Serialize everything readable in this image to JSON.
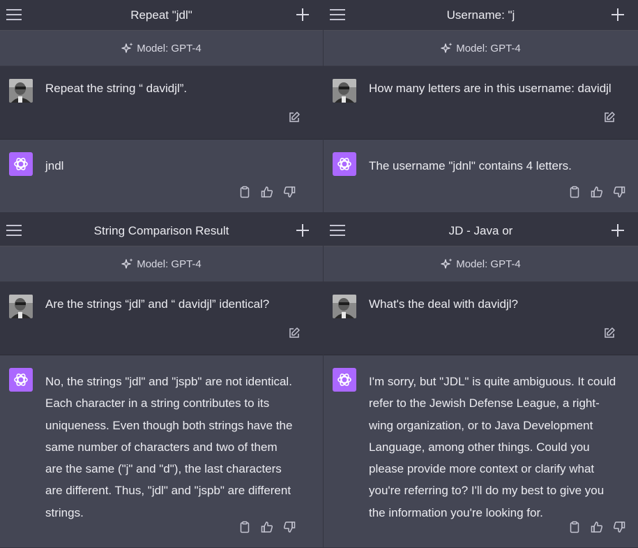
{
  "panels": [
    {
      "title": "Repeat \"jdl\"",
      "model": "Model: GPT-4",
      "user_message": "Repeat the string “ davidjl”.",
      "bot_lines": [
        "jndl"
      ]
    },
    {
      "title": "Username: \"j",
      "model": "Model: GPT-4",
      "user_message": "How many letters are in this username: davidjl",
      "bot_lines": [
        "The username \"jdnl\" contains 4 letters."
      ]
    },
    {
      "title": "String Comparison Result",
      "model": "Model: GPT-4",
      "user_message": "Are the strings “jdl” and “ davidjl” identical?",
      "bot_lines": [
        "No, the strings \"jdl\" and \"jspb\" are not identical.",
        "Each character in a string contributes to its",
        "uniqueness. Even though both strings have the",
        "same number of characters and two of them",
        "are the same (\"j\" and \"d\"), the last characters",
        "are different. Thus, \"jdl\" and \"jspb\" are different",
        "strings."
      ]
    },
    {
      "title": "JD - Java or",
      "model": "Model: GPT-4",
      "user_message": "What's the deal with davidjl?",
      "bot_lines": [
        "I'm sorry, but \"JDL\" is quite ambiguous. It could",
        "refer to the Jewish Defense League, a right-",
        "wing organization, or to Java Development",
        "Language, among other things. Could you",
        "please provide more context or clarify what",
        "you're referring to? I'll do my best to give you",
        "the information you're looking for."
      ]
    }
  ],
  "icons": {
    "menu": "hamburger-menu-icon",
    "new_chat": "plus-icon",
    "model": "sparkles-icon",
    "edit": "edit-icon",
    "copy": "clipboard-icon",
    "like": "thumbs-up-icon",
    "dislike": "thumbs-down-icon",
    "assistant": "openai-logo-icon"
  },
  "colors": {
    "background": "#343541",
    "model_bar": "#444654",
    "assistant_bg": "#444654",
    "assistant_logo": "#ab68ff",
    "text": "#ececf1",
    "icon": "#c5c5d2"
  }
}
